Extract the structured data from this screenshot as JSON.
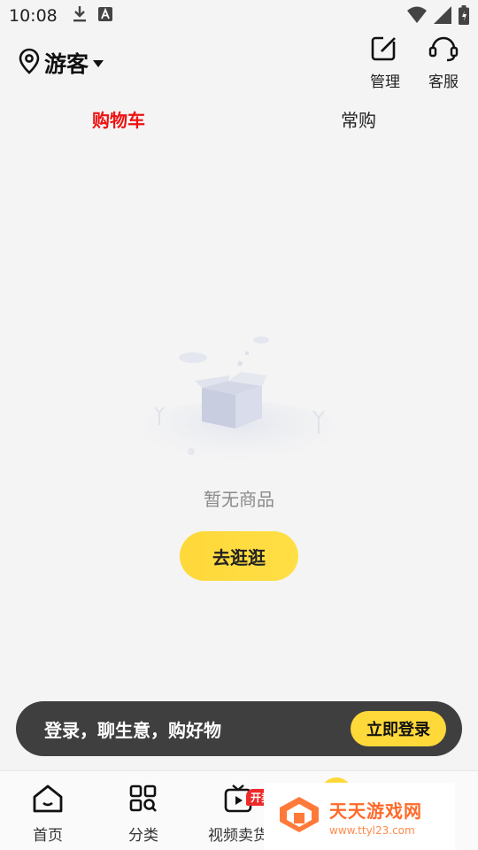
{
  "status_bar": {
    "time": "10:08"
  },
  "header": {
    "location": "游客",
    "manage_label": "管理",
    "service_label": "客服"
  },
  "tabs": [
    {
      "label": "购物车",
      "active": true
    },
    {
      "label": "常购",
      "active": false
    }
  ],
  "empty_state": {
    "text": "暂无商品",
    "button_label": "去逛逛"
  },
  "login_banner": {
    "text": "登录，聊生意，购好物",
    "button_label": "立即登录"
  },
  "bottom_nav": {
    "items": [
      {
        "label": "首页",
        "icon": "home-icon"
      },
      {
        "label": "分类",
        "icon": "category-icon"
      },
      {
        "label": "视频卖货",
        "icon": "video-icon",
        "badge": "开卖"
      }
    ]
  },
  "watermark": {
    "title": "天天游戏网",
    "url": "www.ttyl23.com"
  },
  "colors": {
    "accent_yellow": "#ffd83a",
    "active_tab_red": "#ee1111",
    "banner_dark": "#3f3f3f",
    "background": "#f4f4f4"
  }
}
